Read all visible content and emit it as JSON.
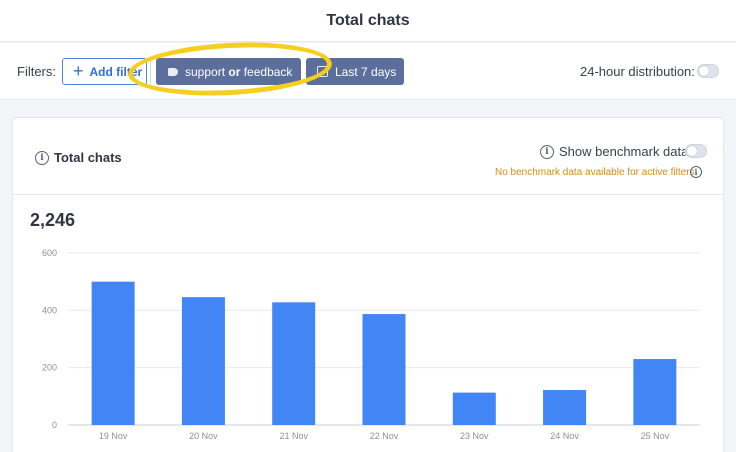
{
  "header": {
    "title": "Total chats"
  },
  "filters": {
    "label": "Filters:",
    "add_filter_label": "Add filter",
    "tag_chip": {
      "part1": "support",
      "connector": "or",
      "part2": "feedback"
    },
    "date_chip_label": "Last 7 days",
    "distribution_label": "24-hour distribution:",
    "distribution_on": false
  },
  "card": {
    "title": "Total chats",
    "benchmark_label": "Show benchmark data",
    "benchmark_on": false,
    "benchmark_note": "No benchmark data available for active filters",
    "total_value": "2,246"
  },
  "colors": {
    "bar": "#4285f4",
    "chip": "#5b6e9c",
    "highlight": "#f5cf1f",
    "note": "#d98b18"
  },
  "chart_data": {
    "type": "bar",
    "categories": [
      "19 Nov",
      "20 Nov",
      "21 Nov",
      "22 Nov",
      "23 Nov",
      "24 Nov",
      "25 Nov"
    ],
    "values": [
      500,
      446,
      428,
      387,
      113,
      122,
      230
    ],
    "yticks": [
      0,
      200,
      400,
      600
    ],
    "ylim": [
      0,
      600
    ],
    "grid": true
  }
}
